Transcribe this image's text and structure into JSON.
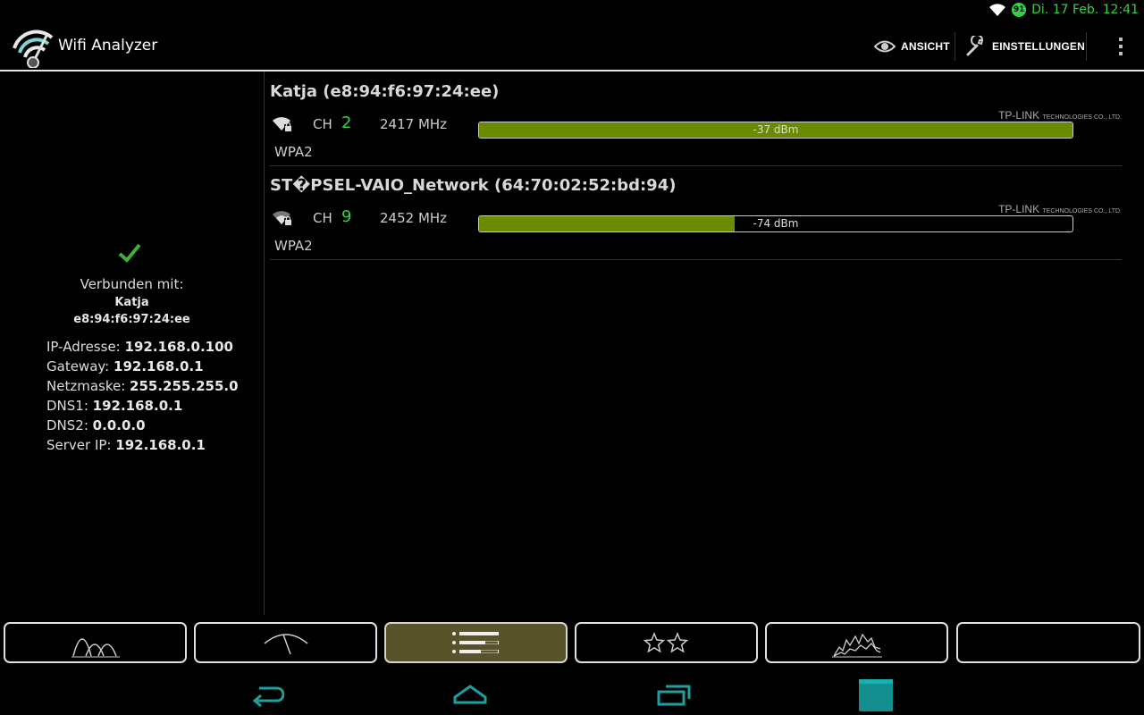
{
  "status": {
    "clock": "Di. 17 Feb. 12:41",
    "battery": "91"
  },
  "app": {
    "title": "Wifi Analyzer"
  },
  "actions": {
    "view": "ANSICHT",
    "settings": "EINSTELLUNGEN"
  },
  "connection": {
    "connected_label": "Verbunden mit:",
    "ssid": "Katja",
    "bssid": "e8:94:f6:97:24:ee",
    "ip_label": "IP-Adresse:",
    "ip": "192.168.0.100",
    "gateway_label": "Gateway:",
    "gateway": "192.168.0.1",
    "netmask_label": "Netzmaske:",
    "netmask": "255.255.255.0",
    "dns1_label": "DNS1:",
    "dns1": "192.168.0.1",
    "dns2_label": "DNS2:",
    "dns2": "0.0.0.0",
    "server_label": "Server IP:",
    "server": "192.168.0.1"
  },
  "networks": [
    {
      "title": "Katja (e8:94:f6:97:24:ee)",
      "ch_label": "CH",
      "channel": "2",
      "freq": "2417 MHz",
      "vendor": "TP-LINK",
      "vendor_suffix": "TECHNOLOGIES CO., LTD.",
      "signal": "-37 dBm",
      "signal_fraction": 1.0,
      "security": "WPA2"
    },
    {
      "title": "ST�PSEL-VAIO_Network (64:70:02:52:bd:94)",
      "ch_label": "CH",
      "channel": "9",
      "freq": "2452 MHz",
      "vendor": "TP-LINK",
      "vendor_suffix": "TECHNOLOGIES CO., LTD.",
      "signal": "-74 dBm",
      "signal_fraction": 0.43,
      "security": "WPA2"
    }
  ],
  "tabs": [
    {
      "icon": "channel-graph-icon",
      "active": false
    },
    {
      "icon": "signal-meter-icon",
      "active": false
    },
    {
      "icon": "ap-list-icon",
      "active": true
    },
    {
      "icon": "channel-rating-icon",
      "active": false
    },
    {
      "icon": "time-graph-icon",
      "active": false
    },
    {
      "icon": "empty-tab",
      "active": false
    }
  ],
  "colors": {
    "accent_green": "#35d04a",
    "signal_bar": "#6a8a00",
    "active_tab": "#58532a",
    "nav_teal": "#1aa0a0"
  }
}
